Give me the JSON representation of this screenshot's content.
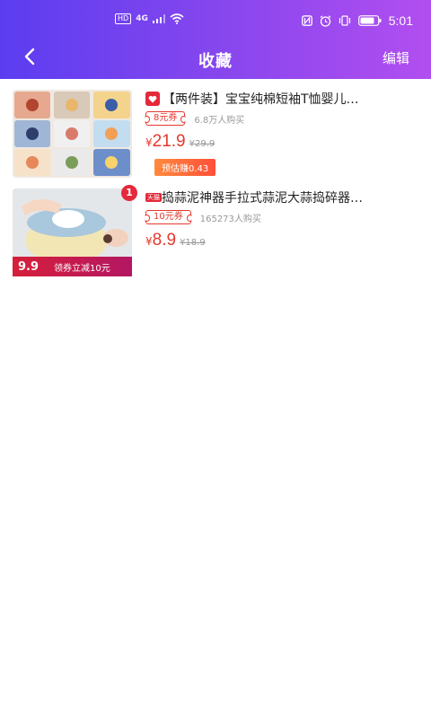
{
  "status_bar": {
    "left_badges": [
      "HD",
      "4G"
    ],
    "time": "5:01"
  },
  "header": {
    "title": "收藏",
    "edit_label": "编辑"
  },
  "items": [
    {
      "title": "【两件装】宝宝纯棉短袖T恤婴儿…",
      "coupon": "8元券",
      "sold": "6.8万人购买",
      "price_symbol": "¥",
      "price": "21.9",
      "old_price": "¥29.9",
      "earn": "预估赚0.43",
      "shop_icon": "tmall-heart-icon"
    },
    {
      "title": "捣蒜泥神器手拉式蒜泥大蒜捣碎器…",
      "tag": "天猫",
      "coupon": "10元券",
      "sold": "165273人购买",
      "price_symbol": "¥",
      "price": "8.9",
      "old_price": "¥18.9",
      "badge": "1",
      "promo_price": "9.9",
      "promo_label": "领券立减10元"
    }
  ],
  "colors": {
    "header_start": "#5b3df0",
    "header_end": "#b24ef0",
    "price_red": "#e4382e",
    "earn_orange": "#ff6a3a"
  }
}
